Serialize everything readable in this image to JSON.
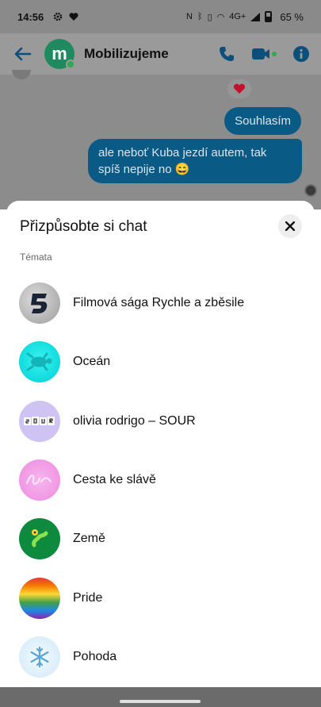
{
  "status_bar": {
    "time": "14:56",
    "network": "4G+",
    "battery": "65 %"
  },
  "header": {
    "title": "Mobilizujeme",
    "avatar_letter": "m",
    "colors": {
      "accent": "#0a5a86",
      "avatar": "#1f8a5f"
    }
  },
  "chat": {
    "messages": [
      {
        "text": "Souhlasím"
      },
      {
        "text": "ale neboť Kuba jezdí autem, tak spíš nepije no 😄"
      }
    ]
  },
  "sheet": {
    "title": "Přizpůsobte si chat",
    "section_label": "Témata",
    "themes": [
      {
        "label": "Filmová sága Rychle a zběsile",
        "icon": "fast-furious-icon"
      },
      {
        "label": "Oceán",
        "icon": "turtle-icon"
      },
      {
        "label": "olivia rodrigo – SOUR",
        "icon": "sour-icon"
      },
      {
        "label": "Cesta ke slávě",
        "icon": "star-neon-icon"
      },
      {
        "label": "Země",
        "icon": "earth-icon"
      },
      {
        "label": "Pride",
        "icon": "rainbow-icon"
      },
      {
        "label": "Pohoda",
        "icon": "snowflake-icon"
      }
    ]
  }
}
